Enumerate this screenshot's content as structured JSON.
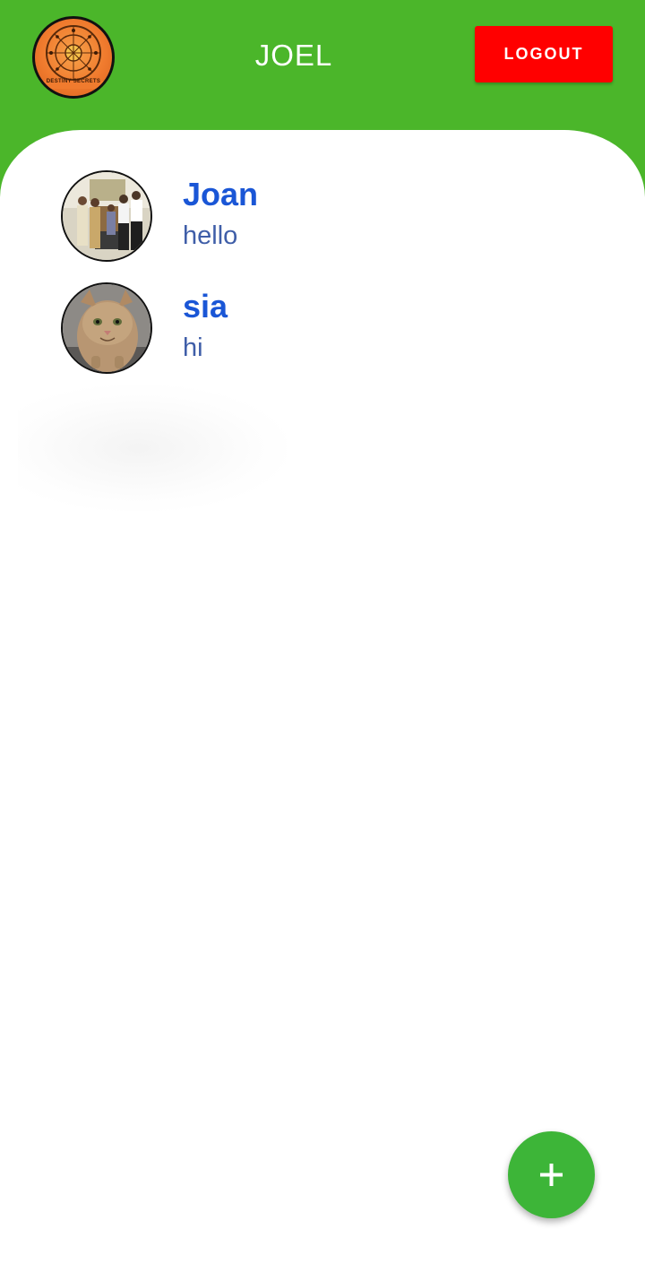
{
  "header": {
    "logo_icon": "destiny-secrets-logo",
    "logo_text": "DESTINY SECRETS",
    "title": "JOEL",
    "logout_label": "LOGOUT",
    "background_color": "#4bb62a",
    "logout_color": "#ff0000"
  },
  "chats": [
    {
      "name": "Joan",
      "last_message": "hello",
      "avatar": "group-photo-avatar"
    },
    {
      "name": "sia",
      "last_message": "hi",
      "avatar": "cat-photo-avatar"
    }
  ],
  "fab": {
    "label": "+",
    "icon": "plus-icon",
    "color": "#3db538"
  },
  "colors": {
    "name_text": "#1a56d6",
    "message_text": "#3f5ea8"
  }
}
